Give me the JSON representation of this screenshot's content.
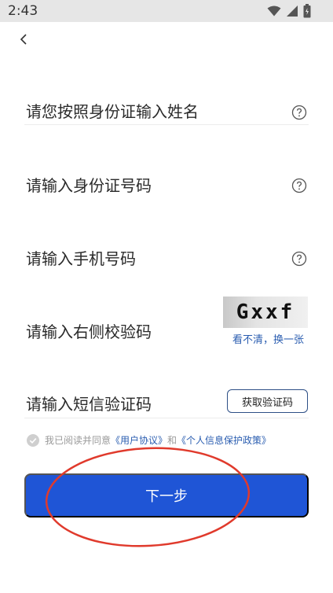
{
  "status_bar": {
    "time": "2:43",
    "icons": [
      "wifi-icon",
      "signal-icon",
      "battery-icon"
    ]
  },
  "nav": {
    "back_icon": "chevron-left-icon"
  },
  "form": {
    "name_placeholder": "请您按照身份证输入姓名",
    "id_placeholder": "请输入身份证号码",
    "phone_placeholder": "请输入手机号码",
    "captcha_placeholder": "请输入右侧校验码",
    "captcha_code": "Gxxf",
    "captcha_refresh": "看不清，换一张",
    "sms_placeholder": "请输入短信验证码",
    "sms_button": "获取验证码",
    "help_icon": "question-circle-icon"
  },
  "agreement": {
    "prefix": "我已阅读并同意",
    "user_agreement": "《用户协议》",
    "conjunction": "和",
    "privacy_policy": "《个人信息保护政策》"
  },
  "actions": {
    "next": "下一步"
  },
  "colors": {
    "primary": "#1f55d6",
    "link": "#2a5db0",
    "annotation": "#e03a2c"
  }
}
